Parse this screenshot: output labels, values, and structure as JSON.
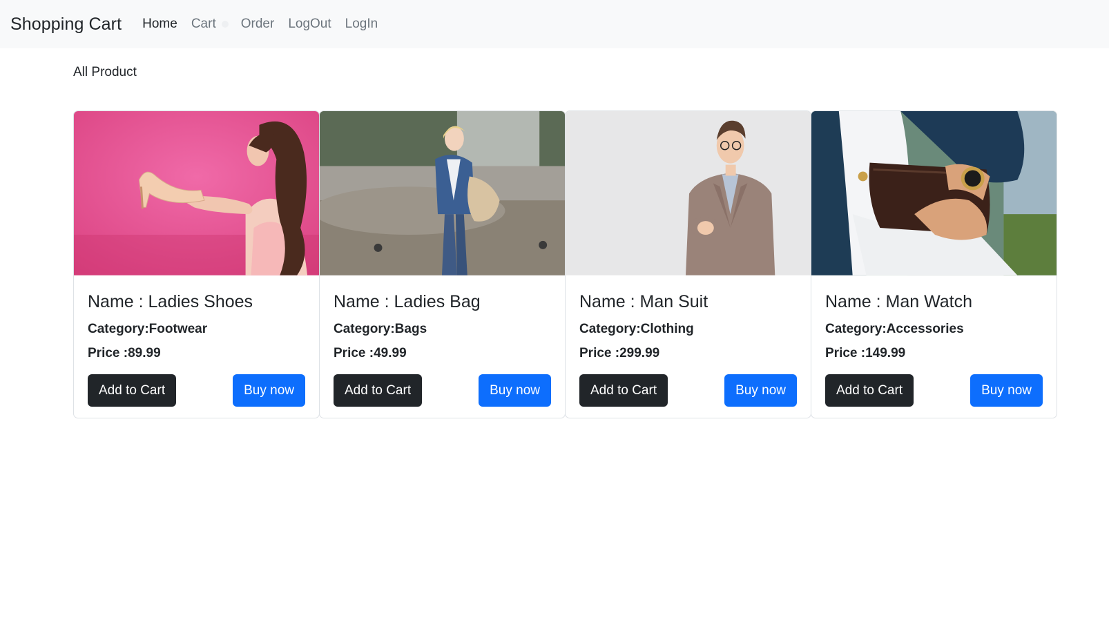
{
  "navbar": {
    "brand": "Shopping Cart",
    "links": [
      {
        "label": "Home"
      },
      {
        "label": "Cart"
      },
      {
        "label": "Order"
      },
      {
        "label": "LogOut"
      },
      {
        "label": "LogIn"
      }
    ]
  },
  "page": {
    "heading": "All Product"
  },
  "products": [
    {
      "name": "Name : Ladies Shoes",
      "category": "Category:Footwear",
      "price": "Price :89.99",
      "add_label": "Add to Cart",
      "buy_label": "Buy now"
    },
    {
      "name": "Name : Ladies Bag",
      "category": "Category:Bags",
      "price": "Price :49.99",
      "add_label": "Add to Cart",
      "buy_label": "Buy now"
    },
    {
      "name": "Name : Man Suit",
      "category": "Category:Clothing",
      "price": "Price :299.99",
      "add_label": "Add to Cart",
      "buy_label": "Buy now"
    },
    {
      "name": "Name : Man Watch",
      "category": "Category:Accessories",
      "price": "Price :149.99",
      "add_label": "Add to Cart",
      "buy_label": "Buy now"
    }
  ],
  "colors": {
    "navbar_bg": "#f8f9fa",
    "btn_dark": "#212529",
    "btn_primary": "#0d6efd"
  }
}
